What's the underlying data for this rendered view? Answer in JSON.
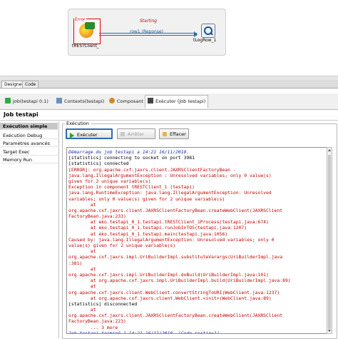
{
  "designer": {
    "component1": {
      "label": "tRESTClient_",
      "error_badge": "Error"
    },
    "component2": {
      "label": "tLogRow_1"
    },
    "status": "Starting",
    "link_label": "row1 (Reponse)"
  },
  "mode_tabs": [
    {
      "label": "Designer",
      "active": true
    },
    {
      "label": "Code",
      "active": false
    }
  ],
  "view_tabs": [
    {
      "label": "Job(testapi 0.1)",
      "icon": "run-job-icon",
      "active": false
    },
    {
      "label": "Contexts(testapi)",
      "icon": "contexts-icon",
      "active": false
    },
    {
      "label": "Composant",
      "icon": "component-icon",
      "active": false
    },
    {
      "label": "Exécuter (Job testapi)",
      "icon": "execute-icon",
      "active": true
    }
  ],
  "job_title": "Job testapi",
  "sidebar": {
    "items": [
      {
        "label": "Exécution simple",
        "active": true
      },
      {
        "label": "Exécution Debug",
        "active": false
      },
      {
        "label": "Paramètres avancés",
        "active": false
      },
      {
        "label": "Target Exec",
        "active": false
      },
      {
        "label": "Memory Run",
        "active": false
      }
    ]
  },
  "execution": {
    "group_label": "Exécution",
    "buttons": {
      "run": "Exécuter",
      "stop": "Arrêter",
      "clear": "Effacer"
    }
  },
  "console": {
    "lines": [
      {
        "text": "Démarrage du job testapi a 14:21 16/11/2018.",
        "color": "blue"
      },
      {
        "text": "[statistics] connecting to socket on port 3981",
        "color": "black"
      },
      {
        "text": "[statistics] connected",
        "color": "black"
      },
      {
        "text": "[ERROR]: org.apache.cxf.jaxrs.client.JAXRSClientFactoryBean -",
        "color": "red"
      },
      {
        "text": "java.lang.IllegalArgumentException : Unresolved variables; only 0 value(s)",
        "color": "red"
      },
      {
        "text": "given for 2 unique variable(s)",
        "color": "red"
      },
      {
        "text": "Exception in component tRESTClient_1 (testapi)",
        "color": "red"
      },
      {
        "text": "java.lang.RuntimeException: java.lang.IllegalArgumentException: Unresolved",
        "color": "red"
      },
      {
        "text": "variables; only 0 value(s) given for 2 unique variable(s)",
        "color": "red"
      },
      {
        "text": "        at",
        "color": "red"
      },
      {
        "text": "org.apache.cxf.jaxrs.client.JAXRSClientFactoryBean.createWebClient(JAXRSClient",
        "color": "red"
      },
      {
        "text": "FactoryBean.java:233)",
        "color": "red"
      },
      {
        "text": "        at eko.testapi_0_1.testapi.tRESTClient_1Process(testapi.java:674)",
        "color": "red"
      },
      {
        "text": "        at eko.testapi_0_1.testapi.runJobInTOS(testapi.java:1207)",
        "color": "red"
      },
      {
        "text": "        at eko.testapi_0_1.testapi.main(testapi.java:1056)",
        "color": "red"
      },
      {
        "text": "Caused by: java.lang.IllegalArgumentException: Unresolved variables; only 0",
        "color": "red"
      },
      {
        "text": "value(s) given for 2 unique variable(s)",
        "color": "red"
      },
      {
        "text": "        at",
        "color": "red"
      },
      {
        "text": "org.apache.cxf.jaxrs.impl.UriBuilderImpl.substituteVarargs(UriBuilderImpl.java",
        "color": "red"
      },
      {
        "text": ":381)",
        "color": "red"
      },
      {
        "text": "        at",
        "color": "red"
      },
      {
        "text": "org.apache.cxf.jaxrs.impl.UriBuilderImpl.doBuild(UriBuilderImpl.java:101)",
        "color": "red"
      },
      {
        "text": "        at org.apache.cxf.jaxrs.impl.UriBuilderImpl.build(UriBuilderImpl.java:89)",
        "color": "red"
      },
      {
        "text": "        at",
        "color": "red"
      },
      {
        "text": "org.apache.cxf.jaxrs.client.WebClient.convertStringToURI(WebClient.java:1237)",
        "color": "red"
      },
      {
        "text": "        at org.apache.cxf.jaxrs.client.WebClient.<init>(WebClient.java:89)",
        "color": "red"
      },
      {
        "text": "[statistics] disconnected",
        "color": "black"
      },
      {
        "text": "        at",
        "color": "red"
      },
      {
        "text": "org.apache.cxf.jaxrs.client.JAXRSClientFactoryBean.createWebClient(JAXRSClient",
        "color": "red"
      },
      {
        "text": "FactoryBean.java:223)",
        "color": "red"
      },
      {
        "text": "        ... 3 more",
        "color": "red"
      },
      {
        "text": "Job testapi terminé à 14:21 16/11/2018. [Code sortie=1]",
        "color": "blue"
      }
    ]
  }
}
